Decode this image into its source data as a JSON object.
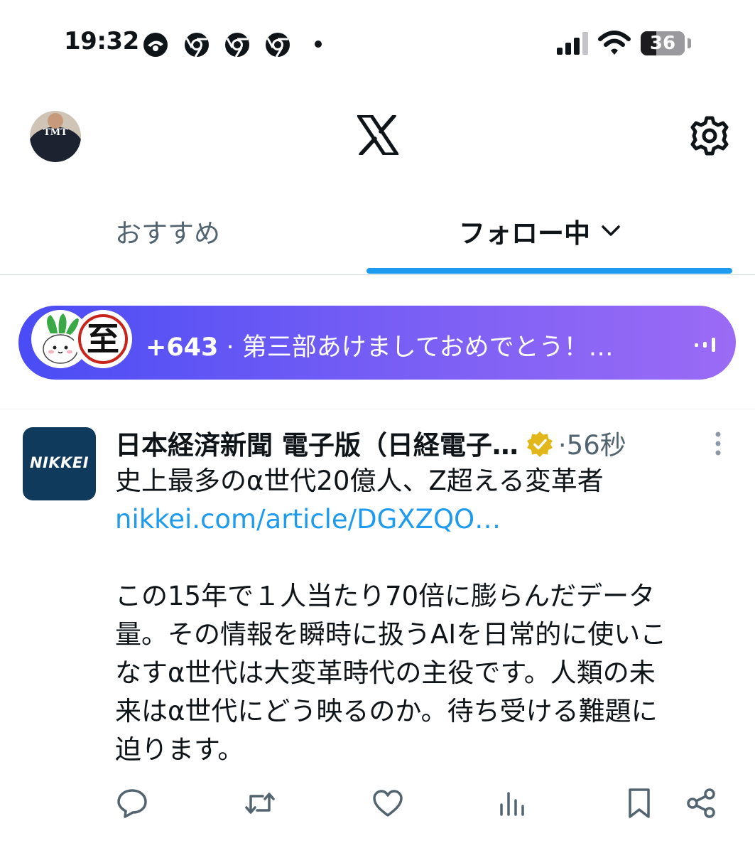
{
  "status_bar": {
    "time": "19:32",
    "battery_percent": 36,
    "battery_label": "36",
    "notification_icons": [
      "app-icon",
      "chrome-icon",
      "chrome-icon",
      "chrome-icon"
    ],
    "signal_bars": 4
  },
  "header": {
    "profile_avatar_text": "TMT",
    "logo": "x-logo-icon",
    "settings_icon": "gear-icon"
  },
  "tabs": [
    {
      "label": "おすすめ",
      "active": false
    },
    {
      "label": "フォロー中",
      "active": true
    }
  ],
  "colors": {
    "accent": "#1d9bf0",
    "text_primary": "#0f1419",
    "text_secondary": "#536471",
    "banner_gradient_start": "#4a4cf5",
    "banner_gradient_end": "#9b6bf5",
    "verified_gold": "#e2b719"
  },
  "space_banner": {
    "count": "+643",
    "separator": " · ",
    "title": "第三部あけましておめでとう！…",
    "host_avatars": [
      "radish-avatar",
      "kanji-avatar"
    ],
    "host_avatar_kanji": "至"
  },
  "post": {
    "author": "日本経済新聞 電子版（日経電子…",
    "verified": "gold",
    "separator": "·",
    "time": "56秒",
    "avatar_text": "NIKKEI",
    "headline": "史上最多のα世代20億人、Z超える変革者",
    "link": "nikkei.com/article/DGXZQO…",
    "body_lines": [
      "この15年で１人当たり70倍に膨らんだデータ",
      "量。その情報を瞬時に扱うAIを日常的に使いこ",
      "なすα世代は大変革時代の主役です。人類の未",
      "来はα世代にどう映るのか。待ち受ける難題に",
      "迫ります。"
    ]
  },
  "actions": [
    "reply-icon",
    "repost-icon",
    "like-icon",
    "views-icon",
    "bookmark-icon",
    "share-icon"
  ]
}
